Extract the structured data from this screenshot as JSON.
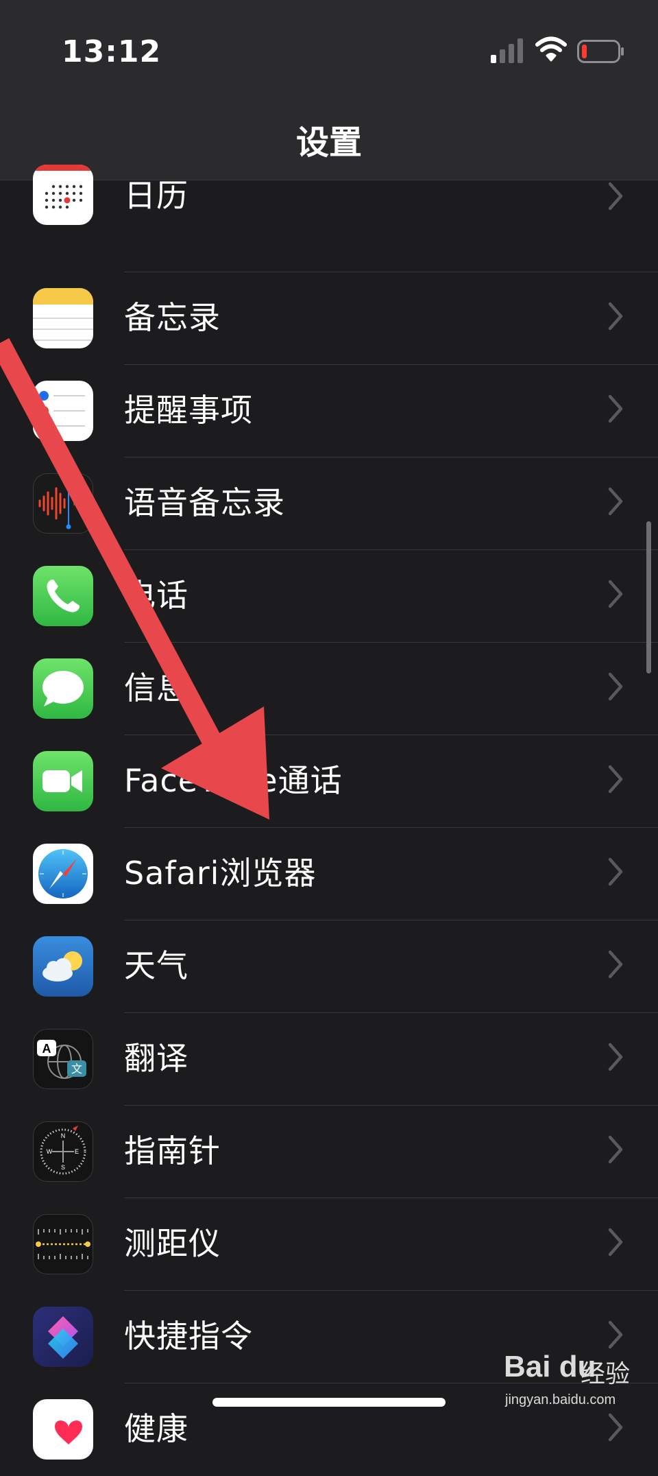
{
  "status_bar": {
    "time": "13:12",
    "signal_icon": "signal-icon",
    "wifi_icon": "wifi-icon",
    "battery_icon": "battery-icon",
    "battery_color": "#ff3b30"
  },
  "nav": {
    "title": "设置"
  },
  "settings_items": [
    {
      "label": "日历",
      "icon": "calendar-icon"
    },
    {
      "label": "备忘录",
      "icon": "notes-icon"
    },
    {
      "label": "提醒事项",
      "icon": "reminders-icon"
    },
    {
      "label": "语音备忘录",
      "icon": "voice-memos-icon"
    },
    {
      "label": "电话",
      "icon": "phone-icon"
    },
    {
      "label": "信息",
      "icon": "messages-icon"
    },
    {
      "label": "FaceTime通话",
      "icon": "facetime-icon"
    },
    {
      "label": "Safari浏览器",
      "icon": "safari-icon"
    },
    {
      "label": "天气",
      "icon": "weather-icon"
    },
    {
      "label": "翻译",
      "icon": "translate-icon"
    },
    {
      "label": "指南针",
      "icon": "compass-icon"
    },
    {
      "label": "测距仪",
      "icon": "measure-icon"
    },
    {
      "label": "快捷指令",
      "icon": "shortcuts-icon"
    },
    {
      "label": "健康",
      "icon": "health-icon"
    }
  ],
  "translate_icon_glyphs": {
    "latin": "A",
    "cjk": "文"
  },
  "compass_icon_letters": {
    "n": "N",
    "e": "E",
    "s": "S",
    "w": "W"
  },
  "annotation": {
    "arrow_color": "#e8474c",
    "target": "Safari浏览器"
  },
  "watermark": {
    "logo": "Bai du",
    "text": "经验",
    "url": "jingyan.baidu.com"
  }
}
